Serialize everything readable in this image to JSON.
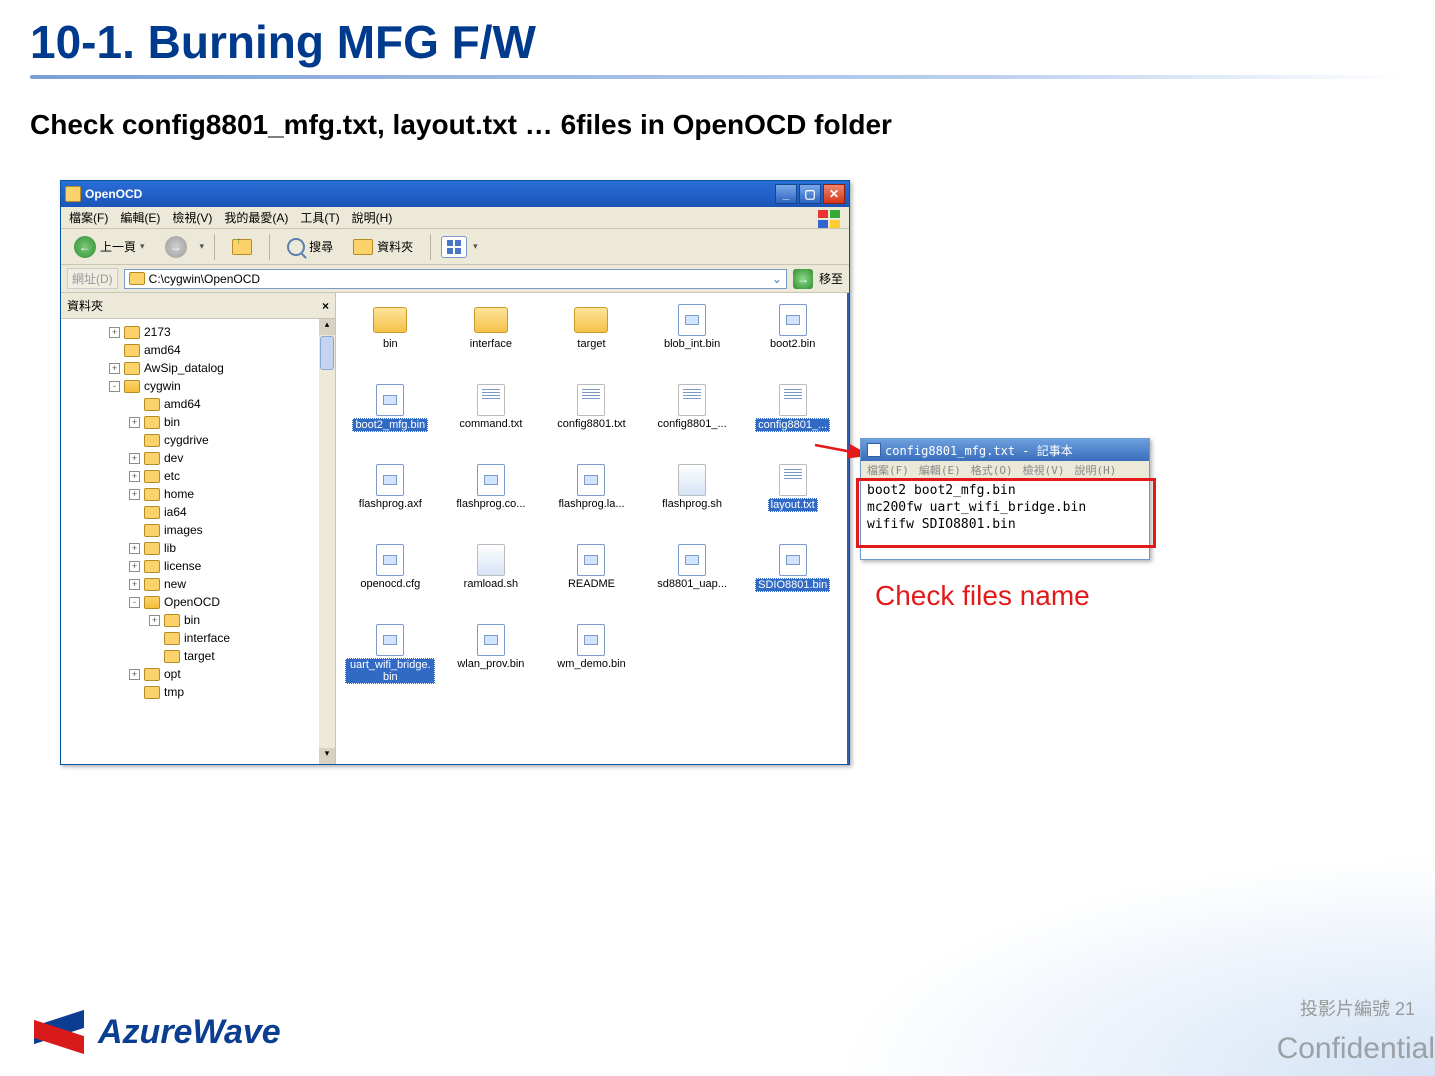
{
  "slide": {
    "title": "10-1. Burning MFG F/W",
    "subtitle": "Check config8801_mfg.txt, layout.txt … 6files in OpenOCD folder",
    "check_label": "Check files name",
    "slide_number_label": "投影片編號 21",
    "confidential": "Confidential",
    "logo_text": "AzureWave"
  },
  "explorer": {
    "title": "OpenOCD",
    "menu": {
      "file": "檔案(F)",
      "edit": "編輯(E)",
      "view": "檢視(V)",
      "fav": "我的最愛(A)",
      "tools": "工具(T)",
      "help": "說明(H)"
    },
    "toolbar": {
      "back": "上一頁",
      "search": "搜尋",
      "folders": "資料夾"
    },
    "address": {
      "label": "網址(D)",
      "path": "C:\\cygwin\\OpenOCD",
      "go": "移至"
    },
    "sidebar": {
      "header": "資料夾"
    },
    "tree": [
      {
        "pad": 44,
        "exp": "+",
        "label": "2173"
      },
      {
        "pad": 44,
        "exp": "",
        "label": "amd64"
      },
      {
        "pad": 44,
        "exp": "+",
        "label": "AwSip_datalog"
      },
      {
        "pad": 44,
        "exp": "-",
        "label": "cygwin",
        "open": true
      },
      {
        "pad": 64,
        "exp": "",
        "label": "amd64"
      },
      {
        "pad": 64,
        "exp": "+",
        "label": "bin"
      },
      {
        "pad": 64,
        "exp": "",
        "label": "cygdrive"
      },
      {
        "pad": 64,
        "exp": "+",
        "label": "dev"
      },
      {
        "pad": 64,
        "exp": "+",
        "label": "etc"
      },
      {
        "pad": 64,
        "exp": "+",
        "label": "home"
      },
      {
        "pad": 64,
        "exp": "",
        "label": "ia64"
      },
      {
        "pad": 64,
        "exp": "",
        "label": "images"
      },
      {
        "pad": 64,
        "exp": "+",
        "label": "lib"
      },
      {
        "pad": 64,
        "exp": "+",
        "label": "license"
      },
      {
        "pad": 64,
        "exp": "+",
        "label": "new"
      },
      {
        "pad": 64,
        "exp": "-",
        "label": "OpenOCD",
        "open": true
      },
      {
        "pad": 84,
        "exp": "+",
        "label": "bin"
      },
      {
        "pad": 84,
        "exp": "",
        "label": "interface"
      },
      {
        "pad": 84,
        "exp": "",
        "label": "target"
      },
      {
        "pad": 64,
        "exp": "+",
        "label": "opt"
      },
      {
        "pad": 64,
        "exp": "",
        "label": "tmp"
      }
    ],
    "tiles": [
      {
        "type": "folder",
        "label": "bin"
      },
      {
        "type": "folder",
        "label": "interface"
      },
      {
        "type": "folder",
        "label": "target"
      },
      {
        "type": "bin",
        "label": "blob_int.bin"
      },
      {
        "type": "bin",
        "label": "boot2.bin"
      },
      {
        "type": "bin",
        "label": "boot2_mfg.bin",
        "sel": true
      },
      {
        "type": "txt",
        "label": "command.txt"
      },
      {
        "type": "txt",
        "label": "config8801.txt"
      },
      {
        "type": "txt",
        "label": "config8801_..."
      },
      {
        "type": "txt",
        "label": "config8801_...",
        "sel": true
      },
      {
        "type": "bin",
        "label": "flashprog.axf"
      },
      {
        "type": "bin",
        "label": "flashprog.co..."
      },
      {
        "type": "bin",
        "label": "flashprog.la..."
      },
      {
        "type": "sh",
        "label": "flashprog.sh"
      },
      {
        "type": "txt",
        "label": "layout.txt",
        "sel": true
      },
      {
        "type": "bin",
        "label": "openocd.cfg"
      },
      {
        "type": "sh",
        "label": "ramload.sh"
      },
      {
        "type": "bin",
        "label": "README"
      },
      {
        "type": "bin",
        "label": "sd8801_uap..."
      },
      {
        "type": "bin",
        "label": "SDIO8801.bin",
        "sel": true
      },
      {
        "type": "bin",
        "label": "uart_wifi_bridge.bin",
        "sel": true
      },
      {
        "type": "bin",
        "label": "wlan_prov.bin"
      },
      {
        "type": "bin",
        "label": "wm_demo.bin"
      }
    ]
  },
  "notepad": {
    "title": "config8801_mfg.txt - 記事本",
    "menu": {
      "file": "檔案(F)",
      "edit": "編輯(E)",
      "format": "格式(O)",
      "view": "檢視(V)",
      "help": "說明(H)"
    },
    "line1": "boot2 boot2_mfg.bin",
    "line2": "mc200fw uart_wifi_bridge.bin",
    "line3": "wififw SDIO8801.bin"
  }
}
